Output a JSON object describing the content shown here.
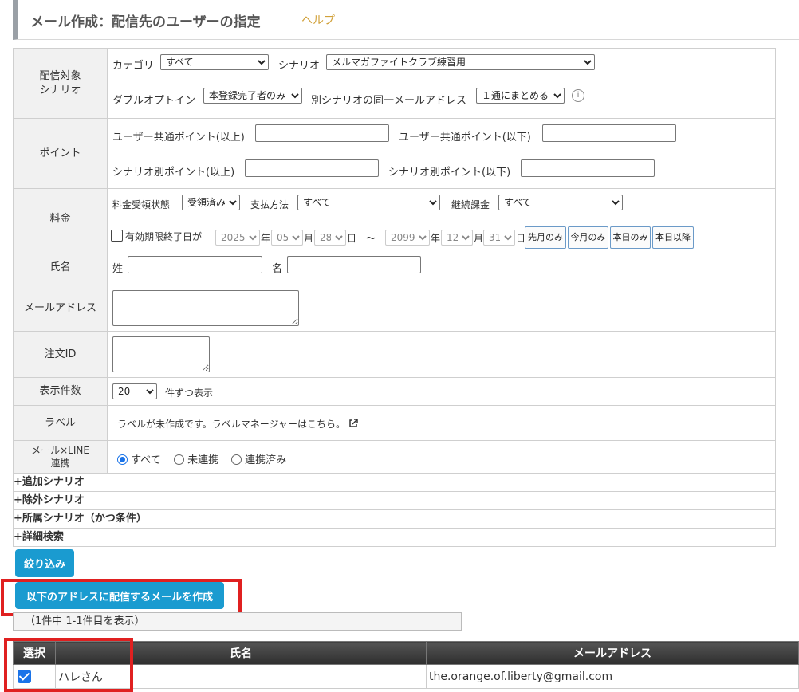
{
  "header": {
    "title": "メール作成：配信先のユーザーの指定",
    "help": "ヘルプ"
  },
  "rows": {
    "scenario": {
      "label": "配信対象\nシナリオ",
      "category_label": "カテゴリ",
      "category_value": "すべて",
      "scenario_label": "シナリオ",
      "scenario_value": "メルマガファイトクラブ練習用",
      "optin_label": "ダブルオプトイン",
      "optin_value": "本登録完了者のみ",
      "dup_label": "別シナリオの同一メールアドレス",
      "dup_value": "１通にまとめる",
      "info_icon": "info-icon"
    },
    "points": {
      "label": "ポイント",
      "common_min_label": "ユーザー共通ポイント(以上)",
      "common_max_label": "ユーザー共通ポイント(以下)",
      "scen_min_label": "シナリオ別ポイント(以上)",
      "scen_max_label": "シナリオ別ポイント(以下)"
    },
    "fee": {
      "label": "料金",
      "status_label": "料金受領状態",
      "status_value": "受領済み",
      "method_label": "支払方法",
      "method_value": "すべて",
      "recurring_label": "継続課金",
      "recurring_value": "すべて",
      "expiry_label": "有効期限終了日が",
      "from_year": "2025",
      "from_month": "05",
      "from_day": "28",
      "to_year": "2099",
      "to_month": "12",
      "to_day": "31",
      "unit_year": "年",
      "unit_month": "月",
      "unit_day": "日",
      "tilde": "～",
      "btn_last_month": "先月のみ",
      "btn_this_month": "今月のみ",
      "btn_today": "本日のみ",
      "btn_after_today": "本日以降"
    },
    "name": {
      "label": "氏名",
      "sei": "姓",
      "mei": "名"
    },
    "email": {
      "label": "メールアドレス"
    },
    "order": {
      "label": "注文ID"
    },
    "count": {
      "label": "表示件数",
      "value": "20",
      "suffix": "件ずつ表示"
    },
    "tag": {
      "label": "ラベル",
      "text": "ラベルが未作成です。ラベルマネージャーはこちら。"
    },
    "line": {
      "label": "メール×LINE\n連携",
      "opt_all": "すべて",
      "opt_unlinked": "未連携",
      "opt_linked": "連携済み"
    }
  },
  "expanders": [
    "+追加シナリオ",
    "+除外シナリオ",
    "+所属シナリオ（かつ条件）",
    "+詳細検索"
  ],
  "buttons": {
    "filter": "絞り込み",
    "create": "以下のアドレスに配信するメールを作成"
  },
  "result_text": "（1件中 1-1件目を表示）",
  "results": {
    "headers": {
      "select": "選択",
      "name": "氏名",
      "email": "メールアドレス"
    },
    "rows": [
      {
        "name": "ハレさん",
        "email": "the.orange.of.liberty@gmail.com",
        "checked": true
      }
    ]
  },
  "colors": {
    "accent_blue": "#1a9bd0",
    "highlight_red": "#e02020",
    "help": "#d1a13a"
  }
}
